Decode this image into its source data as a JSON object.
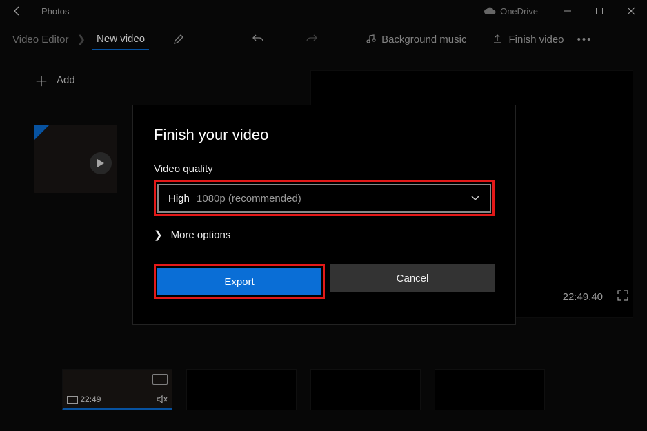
{
  "titlebar": {
    "app": "Photos",
    "onedrive": "OneDrive"
  },
  "toolbar": {
    "breadcrumb": "Video Editor",
    "newvideo": "New video",
    "bgmusic": "Background music",
    "finish": "Finish video"
  },
  "leftpanel": {
    "add": "Add"
  },
  "preview": {
    "time": "22:49.40"
  },
  "strip": {
    "clip1_time": "22:49"
  },
  "dialog": {
    "title": "Finish your video",
    "quality_label": "Video quality",
    "quality_prefix": "High",
    "quality_suffix": "1080p (recommended)",
    "more": "More options",
    "export": "Export",
    "cancel": "Cancel"
  }
}
